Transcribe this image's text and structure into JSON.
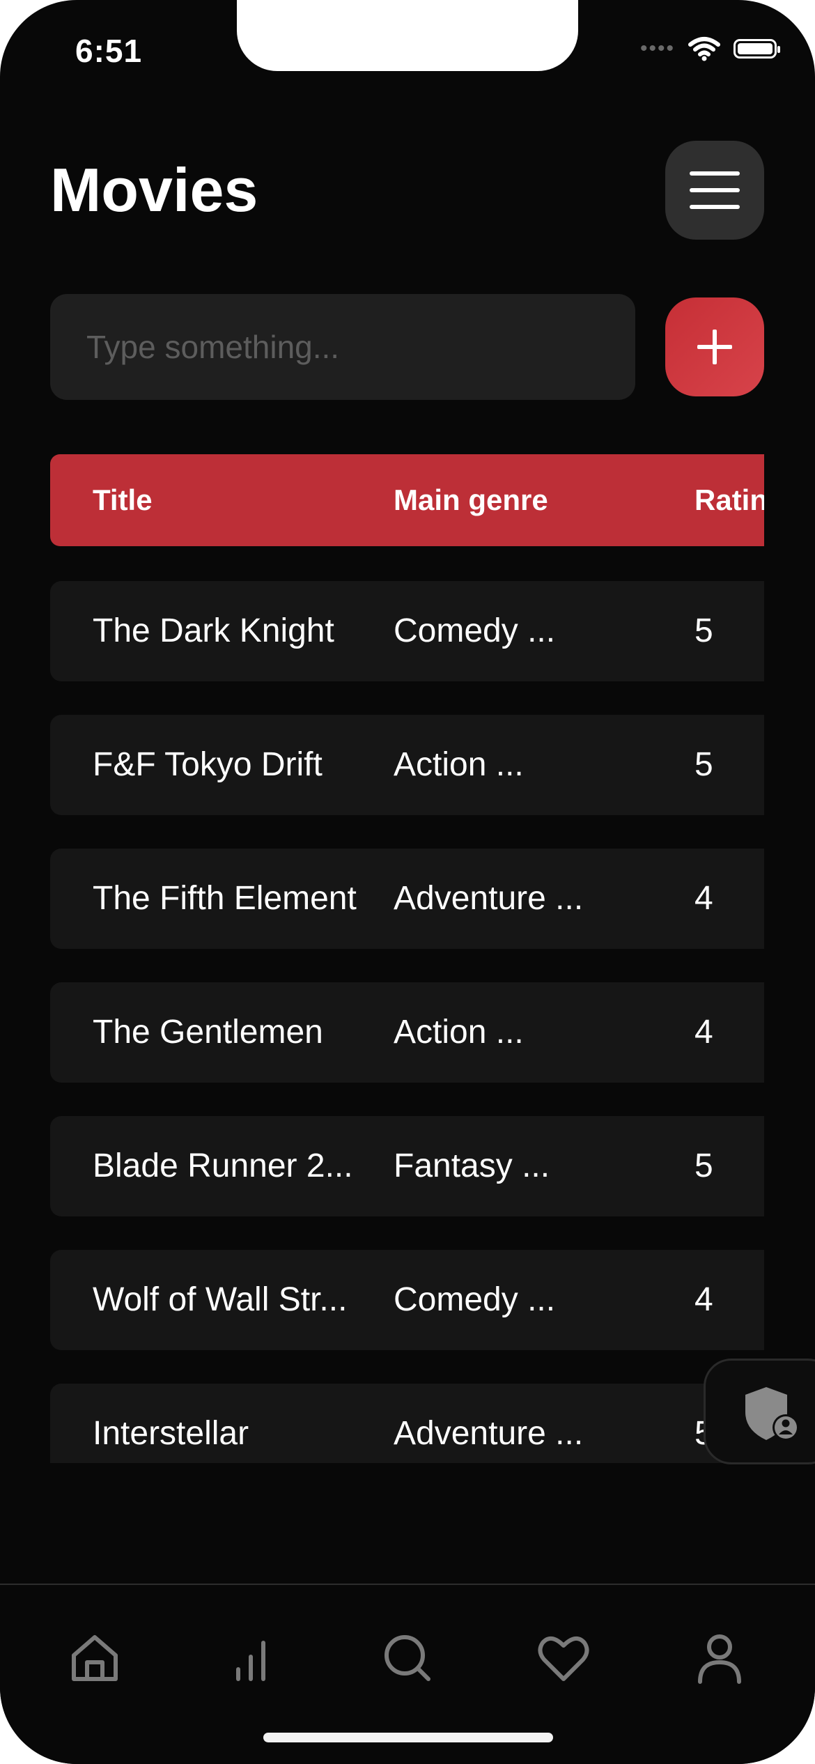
{
  "status_bar": {
    "time": "6:51",
    "signal_dots": "••••"
  },
  "header": {
    "title": "Movies",
    "menu_icon": "hamburger-menu-icon"
  },
  "search": {
    "placeholder": "Type something...",
    "value": ""
  },
  "add_button": {
    "icon": "plus-icon",
    "color": "#c62f36"
  },
  "table": {
    "header_color": "#bd2f37",
    "columns": [
      "Title",
      "Main genre",
      "Ratin"
    ],
    "rows": [
      {
        "title": "The Dark Knight",
        "genre": "Comedy ...",
        "rating": "5"
      },
      {
        "title": "F&F Tokyo Drift",
        "genre": "Action ...",
        "rating": "5"
      },
      {
        "title": "The Fifth Element",
        "genre": "Adventure ...",
        "rating": "4"
      },
      {
        "title": "The Gentlemen",
        "genre": "Action ...",
        "rating": "4"
      },
      {
        "title": "Blade Runner 2...",
        "genre": "Fantasy ...",
        "rating": "5"
      },
      {
        "title": "Wolf of Wall Str...",
        "genre": "Comedy ...",
        "rating": "4"
      },
      {
        "title": "Interstellar",
        "genre": "Adventure ...",
        "rating": "5"
      }
    ]
  },
  "floating_badge": {
    "icon": "shield-user-icon"
  },
  "bottom_nav": {
    "items": [
      {
        "name": "home",
        "icon": "home-icon"
      },
      {
        "name": "stats",
        "icon": "bar-chart-icon"
      },
      {
        "name": "search",
        "icon": "search-icon"
      },
      {
        "name": "favorites",
        "icon": "heart-icon"
      },
      {
        "name": "profile",
        "icon": "user-icon"
      }
    ]
  }
}
